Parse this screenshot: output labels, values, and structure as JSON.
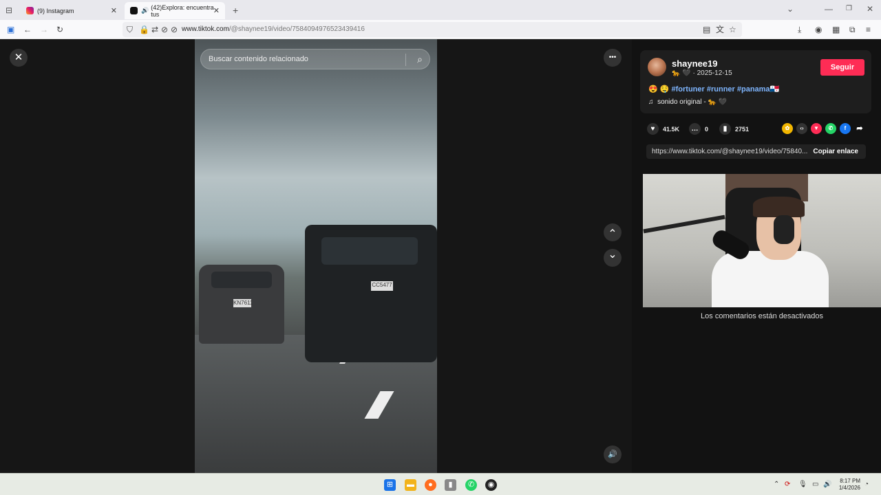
{
  "browser": {
    "tabs": [
      {
        "label": "(9) Instagram",
        "favicon": "instagram-icon"
      },
      {
        "label": "(42)Explora: encuentra tus",
        "favicon": "tiktok-icon"
      }
    ],
    "new_tab": "+",
    "url_host": "www.tiktok.com",
    "url_path": "/@shaynee19/video/7584094976523439416"
  },
  "video": {
    "search_placeholder": "Buscar contenido relacionado",
    "plate_left": "KN7611",
    "plate_right": "CC5477"
  },
  "controls": {
    "close": "✕",
    "more": "•••",
    "up": "⌃",
    "down": "⌄",
    "volume": "🔊"
  },
  "post": {
    "username": "shaynee19",
    "date": "· 2025-12-15",
    "follow_label": "Seguir",
    "emojis": "😍 🤤",
    "hashtags": "#fortuner #runner #panama",
    "flag": "🇵🇦",
    "music": "sonido original -",
    "likes": "41.5K",
    "comments": "0",
    "saves": "2751",
    "link": "https://www.tiktok.com/@shaynee19/video/75840...",
    "copy_label": "Copiar enlace",
    "comments_disabled": "Los comentarios están desactivados"
  },
  "taskbar": {
    "time": "8:17 PM",
    "date": "1/4/2026"
  },
  "colors": {
    "follow": "#fe2c55",
    "hashtag": "#7fb6ff"
  }
}
